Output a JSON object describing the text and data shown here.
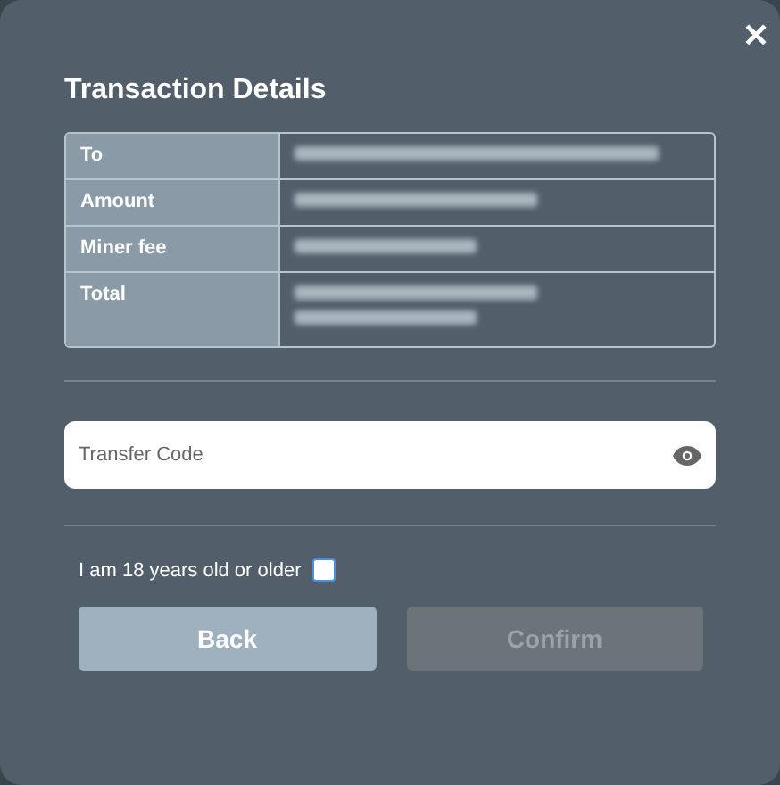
{
  "dialog": {
    "close_label": "✕",
    "title": "Transaction Details"
  },
  "details": [
    {
      "label": "To",
      "value_lines": [
        {
          "kind": "redacted"
        }
      ]
    },
    {
      "label": "Amount",
      "value_lines": [
        {
          "kind": "redacted"
        }
      ]
    },
    {
      "label": "Miner fee",
      "value_lines": [
        {
          "kind": "redacted"
        }
      ]
    },
    {
      "label": "Total",
      "value_lines": [
        {
          "kind": "redacted"
        },
        {
          "kind": "redacted"
        }
      ]
    }
  ],
  "transfer_code": {
    "placeholder": "Transfer Code"
  },
  "age_check": {
    "label": "I am 18 years old or older",
    "checked": false
  },
  "buttons": [
    {
      "label": "Back",
      "kind": "secondary",
      "disabled": false
    },
    {
      "label": "Confirm",
      "kind": "primary",
      "disabled": true
    }
  ]
}
